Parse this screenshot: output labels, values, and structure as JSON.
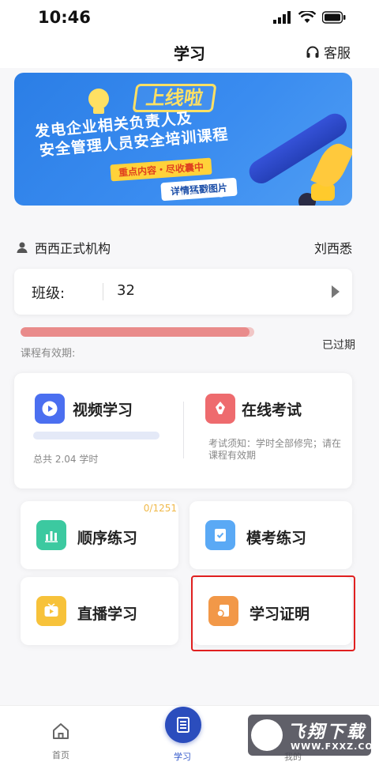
{
  "status": {
    "time": "10:46"
  },
  "nav": {
    "title": "学习",
    "service_label": "客服"
  },
  "banner": {
    "headline": "上线啦",
    "line1": "发电企业相关负责人及",
    "line2": "安全管理人员安全培训课程",
    "tag": "重点内容・尽收囊中",
    "detail_button": "详情猛戳图片"
  },
  "org": {
    "name": "西西正式机构",
    "user": "刘西悉"
  },
  "class": {
    "label": "班级:",
    "value": "32"
  },
  "validity": {
    "label": "课程有效期:",
    "status": "已过期",
    "progress_fraction": 0.98
  },
  "main_card": {
    "video": {
      "title": "视频学习",
      "hours": "总共 2.04 学时",
      "progress_fraction": 0
    },
    "exam": {
      "title": "在线考试",
      "note": "考试须知：学时全部修完；请在课程有效期"
    }
  },
  "tiles": {
    "sequence": {
      "label": "顺序练习",
      "count": "0/1251"
    },
    "mock": {
      "label": "模考练习"
    },
    "live": {
      "label": "直播学习"
    },
    "certificate": {
      "label": "学习证明"
    }
  },
  "tabbar": {
    "home": "首页",
    "study": "学习",
    "mine": "我的"
  },
  "watermark": {
    "brand": "飞翔下载",
    "url": "WWW.FXXZ.COM"
  },
  "colors": {
    "accent": "#2b4dbd",
    "video_icon": "#4b6ff0",
    "exam_icon": "#ee6b6e",
    "sequence_icon": "#3cc9a0",
    "mock_icon": "#5aa9f5",
    "live_icon": "#f7c23a",
    "certificate_icon": "#f29848",
    "highlight": "#e02020"
  },
  "icons": {
    "service": "headset-icon",
    "org": "user-icon",
    "video": "play-icon",
    "exam": "pen-icon",
    "sequence": "bar-chart-icon",
    "mock": "checklist-icon",
    "live": "tv-icon",
    "certificate": "certificate-icon",
    "home": "home-icon",
    "study": "book-icon"
  }
}
